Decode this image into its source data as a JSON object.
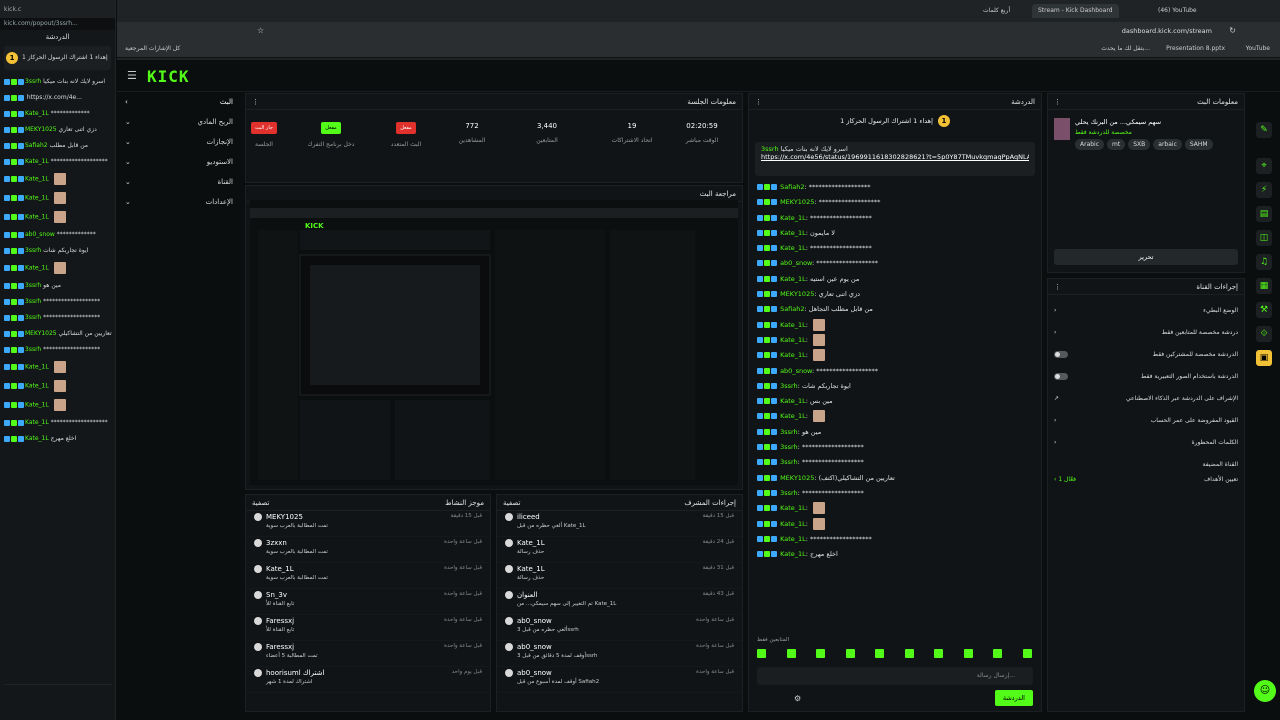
{
  "popout": {
    "window_title": "kick.c",
    "url": "kick.com/popout/3ssrh...",
    "header": "الدردشة",
    "pinned_title": "إهداء 1 اشتراك الرسول الحركاز 1",
    "messages": [
      {
        "user": "3ssrh",
        "text": "اسرو لايك لانه بنات ميكيا"
      },
      {
        "user": "",
        "text": "https://x.com/4e..."
      },
      {
        "user": "Kate_1L",
        "text": "*************"
      },
      {
        "user": "MEKY1025",
        "text": "دزي اتنى تعاري"
      },
      {
        "user": "Safiah2",
        "text": "من قابل مطلب"
      },
      {
        "user": "Kate_1L",
        "text": "*******************"
      },
      {
        "user": "Kate_1L",
        "text": ""
      },
      {
        "user": "Kate_1L",
        "text": ""
      },
      {
        "user": "Kate_1L",
        "text": ""
      },
      {
        "user": "ab0_snow",
        "text": "*************"
      },
      {
        "user": "3ssrh",
        "text": "ايوة تجاربكم شات"
      },
      {
        "user": "Kate_1L",
        "text": ""
      },
      {
        "user": "3ssrh",
        "text": "مين هو"
      },
      {
        "user": "3ssrh",
        "text": "*******************"
      },
      {
        "user": "3ssrh",
        "text": "*******************"
      },
      {
        "user": "MEKY1025",
        "text": "تعاريين من التشاكيلي"
      },
      {
        "user": "3ssrh",
        "text": "*******************"
      },
      {
        "user": "Kate_1L",
        "text": ""
      },
      {
        "user": "Kate_1L",
        "text": ""
      },
      {
        "user": "Kate_1L",
        "text": ""
      },
      {
        "user": "Kate_1L",
        "text": "*******************"
      },
      {
        "user": "Kate_1L",
        "text": "اخلع مهرج"
      }
    ]
  },
  "browser": {
    "tabs": [
      {
        "label": "أربع كلمات"
      },
      {
        "label": "Stream - Kick Dashboard"
      },
      {
        "label": "(46) YouTube"
      }
    ],
    "address": "dashboard.kick.com/stream",
    "bookmarks_folder": "كل الإشارات المرجعية",
    "bookmarks": [
      "بتقل لك ما يحدث...",
      "Presentation 8.pptx",
      "YouTube"
    ]
  },
  "kick": {
    "logo": "KICK",
    "nav": [
      {
        "label": "البث"
      },
      {
        "label": "الربح المادي"
      },
      {
        "label": "الإنجازات"
      },
      {
        "label": "الاستوديو"
      },
      {
        "label": "القناة"
      },
      {
        "label": "الإعدادات"
      }
    ],
    "session": {
      "title": "معلومات الجلسة",
      "stats": [
        {
          "value": "02:20:59",
          "label": "الوقت مباشر"
        },
        {
          "value": "19",
          "label": "اتحاد الاشتراكات"
        },
        {
          "value": "3,440",
          "label": "المتابعين"
        },
        {
          "value": "772",
          "label": "المشاهدين"
        }
      ],
      "buttons": [
        {
          "badge": "مفعل",
          "label": "البث المتعدد",
          "color": "#e0312c"
        },
        {
          "badge": "مفعل",
          "label": "دخل برنامج التفرك",
          "color": "#53fc18"
        },
        {
          "badge": "جار البث",
          "label": "الجلسة",
          "color": "#e0312c"
        }
      ]
    },
    "preview": {
      "title": "مراجعة البث"
    },
    "activity": {
      "title": "موجز النشاط",
      "filter": "تصفية",
      "rows": [
        {
          "name": "MEKY1025",
          "sub": "تمت المطالبة بالعرب سوية",
          "time": "قبل 15 دقيقة"
        },
        {
          "name": "3zxxn",
          "sub": "تمت المطالبة بالعرب سوية",
          "time": "قبل ساعة واحدة"
        },
        {
          "name": "Kate_1L",
          "sub": "تمت المطالبة بالعرب سوية",
          "time": "قبل ساعة واحدة"
        },
        {
          "name": "Sn_3v",
          "sub": "تابع القناة للأ",
          "time": "قبل ساعة واحدة"
        },
        {
          "name": "Faressxj",
          "sub": "تابع القناة للأ",
          "time": "قبل ساعة واحدة"
        },
        {
          "name": "Faressxj",
          "sub": "تمت المطالبة 5 أعضاء",
          "time": "قبل ساعة واحدة"
        },
        {
          "name": "hoorisuml اشتراك",
          "sub": "اشتراك لمدة 1 شهر",
          "time": "قبل يوم واحد"
        }
      ]
    },
    "mod": {
      "title": "إجراءات المشرف",
      "filter": "تصفية",
      "rows": [
        {
          "name": "iliceed",
          "sub": "ألغي حظره من قبل Kate_1L",
          "time": "قبل 15 دقيقة"
        },
        {
          "name": "Kate_1L",
          "sub": "حذف رسالة",
          "time": "قبل 24 دقيقة"
        },
        {
          "name": "Kate_1L",
          "sub": "حذف رسالة",
          "time": "قبل 31 دقيقة"
        },
        {
          "name": "العنوان",
          "sub": "تم التغيير إلى سهم سيمكي... من Kate_1L",
          "time": "قبل 43 دقيقة"
        },
        {
          "name": "ab0_snow",
          "sub": "ألغي حظره من قبل 3ssrh",
          "time": "قبل ساعة واحدة"
        },
        {
          "name": "ab0_snow",
          "sub": "أوقف لمدة 5 دقائق من قبل 3ssrh",
          "time": "قبل ساعة واحدة"
        },
        {
          "name": "ab0_snow",
          "sub": "أوقف لمدة أسبوع من قبل Safiah2",
          "time": "قبل ساعة واحدة"
        }
      ]
    },
    "chat": {
      "title": "الدردشة",
      "pinned": "إهداء 1 اشتراك الرسول الحركاز 1",
      "pin_user": "3ssrh",
      "pin_text": "اسرو لايك لانه بنات ميكيا",
      "pin_link": "https://x.com/4e56/status/1969911618302828621?t=5p0Y87TMuvkqmaqPpAqNLA&s=19",
      "messages": [
        {
          "user": "Safiah2",
          "text": "*******************"
        },
        {
          "user": "MEKY1025",
          "text": "*******************"
        },
        {
          "user": "Kate_1L",
          "text": "*******************"
        },
        {
          "user": "Kate_1L",
          "text": "لا مايمون"
        },
        {
          "user": "Kate_1L",
          "text": "*******************"
        },
        {
          "user": "ab0_snow",
          "text": "*******************"
        },
        {
          "user": "Kate_1L",
          "text": "من يوم عين استيه"
        },
        {
          "user": "MEKY1025",
          "text": "دزي اتنى تعاري"
        },
        {
          "user": "Safiah2",
          "text": "من قابل مطلب التجاهل"
        },
        {
          "user": "Kate_1L",
          "text": ""
        },
        {
          "user": "Kate_1L",
          "text": ""
        },
        {
          "user": "Kate_1L",
          "text": ""
        },
        {
          "user": "ab0_snow",
          "text": "*******************"
        },
        {
          "user": "3ssrh",
          "text": "ايوة تجاربكم شات"
        },
        {
          "user": "Kate_1L",
          "text": "مين بس"
        },
        {
          "user": "Kate_1L",
          "text": ""
        },
        {
          "user": "3ssrh",
          "text": "مين هو"
        },
        {
          "user": "3ssrh",
          "text": "*******************"
        },
        {
          "user": "3ssrh",
          "text": "*******************"
        },
        {
          "user": "MEKY1025",
          "text": "تعاريين من التشاكيلي(اكتف)"
        },
        {
          "user": "3ssrh",
          "text": "*******************"
        },
        {
          "user": "Kate_1L",
          "text": ""
        },
        {
          "user": "Kate_1L",
          "text": ""
        },
        {
          "user": "Kate_1L",
          "text": "*******************"
        },
        {
          "user": "Kate_1L",
          "text": "اخلع مهرج"
        }
      ],
      "followers_only": "المتابعين فقط",
      "input_placeholder": "إرسال رسالة...",
      "send": "الدردشة"
    },
    "stream_info": {
      "title": "معلومات البث",
      "stream_title": "سهم سيمكي... من البرنك يحلي",
      "category": "مخصصة للدردشة فقط",
      "tags": [
        "Arabic",
        "mt",
        "SXB",
        "arbaic",
        "SAHM"
      ],
      "edit": "تحرير"
    },
    "channel_actions": {
      "title": "إجراءات القناة",
      "rows": [
        {
          "label": "الوضع البطيء",
          "control": "arrow"
        },
        {
          "label": "دردشة مخصصة للمتابعين فقط",
          "control": "arrow"
        },
        {
          "label": "الدردشة مخصصة للمشتركين فقط",
          "control": "toggle"
        },
        {
          "label": "الدردشة باستخدام الصور التعبيرية فقط",
          "control": "toggle"
        },
        {
          "label": "الإشراف على الدردشة عبر الذكاء الاصطناعي",
          "control": "link"
        },
        {
          "label": "القيود المفروضة على عمر الحساب",
          "control": "arrow"
        },
        {
          "label": "الكلمات المحظورة",
          "control": "arrow"
        }
      ],
      "section": "القناة المضيفة",
      "host_label": "تعيين الأهداف",
      "host_value": "فعّال 1"
    }
  }
}
